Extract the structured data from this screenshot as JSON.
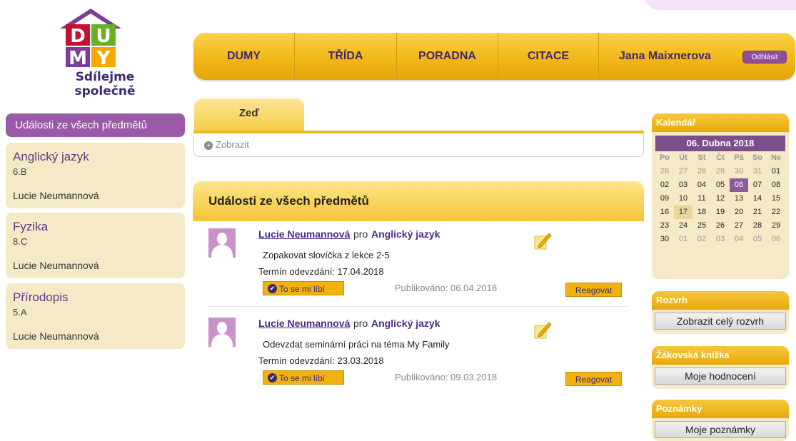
{
  "brand": {
    "logo_letters": [
      "D",
      "U",
      "M",
      "Y"
    ],
    "tagline": "Sdílejme společně",
    "colors": {
      "red": "#c8102e",
      "green": "#6ab023",
      "purple": "#7d3c98",
      "orange": "#f2a900"
    }
  },
  "nav": {
    "items": [
      {
        "label": "DUMY"
      },
      {
        "label": "TŘÍDA"
      },
      {
        "label": "PORADNA"
      },
      {
        "label": "CITACE"
      }
    ],
    "user_name": "Jana Maixnerova",
    "logout_label": "Odhlásit"
  },
  "left": {
    "active_label": "Události ze všech předmětů",
    "subjects": [
      {
        "name": "Anglický jazyk",
        "class": "6.B",
        "teacher": "Lucie Neumannová"
      },
      {
        "name": "Fyzika",
        "class": "8.C",
        "teacher": "Lucie Neumannová"
      },
      {
        "name": "Přírodopis",
        "class": "5.A",
        "teacher": "Lucie Neumannová"
      }
    ]
  },
  "wall": {
    "tab_label": "Zeď",
    "show_label": "Zobrazit"
  },
  "events": {
    "title": "Události ze všech předmětů",
    "items": [
      {
        "author": "Lucie Neumannová",
        "pro": "pro",
        "subject": "Anglický jazyk",
        "text": "Zopakovat slovíčka z lekce 2-5",
        "deadline": "Termín odevzdání: 17.04.2018",
        "like_label": "To se mi líbí",
        "published": "Publikováno: 06.04.2018",
        "react_label": "Reagovat"
      },
      {
        "author": "Lucie Neumannová",
        "pro": "pro",
        "subject": "Anglický jazyk",
        "text": "Odevzdat seminární práci na téma My Family",
        "deadline": "Termín odevzdání: 23.03.2018",
        "like_label": "To se mi líbí",
        "published": "Publikováno: 09.03.2018",
        "react_label": "Reagovat"
      }
    ]
  },
  "calendar": {
    "title": "Kalendář",
    "month_label": "06. Dubna 2018",
    "weekdays": [
      "Po",
      "Út",
      "St",
      "Čt",
      "Pá",
      "So",
      "Ne"
    ],
    "days": [
      {
        "d": "26",
        "state": "dim"
      },
      {
        "d": "27",
        "state": "dim"
      },
      {
        "d": "28",
        "state": "dim"
      },
      {
        "d": "29",
        "state": "dim"
      },
      {
        "d": "30",
        "state": "dim"
      },
      {
        "d": "31",
        "state": "dim"
      },
      {
        "d": "01",
        "state": ""
      },
      {
        "d": "02",
        "state": ""
      },
      {
        "d": "03",
        "state": ""
      },
      {
        "d": "04",
        "state": ""
      },
      {
        "d": "05",
        "state": ""
      },
      {
        "d": "06",
        "state": "sel"
      },
      {
        "d": "07",
        "state": ""
      },
      {
        "d": "08",
        "state": ""
      },
      {
        "d": "09",
        "state": ""
      },
      {
        "d": "10",
        "state": ""
      },
      {
        "d": "11",
        "state": ""
      },
      {
        "d": "12",
        "state": ""
      },
      {
        "d": "13",
        "state": ""
      },
      {
        "d": "14",
        "state": ""
      },
      {
        "d": "15",
        "state": ""
      },
      {
        "d": "16",
        "state": ""
      },
      {
        "d": "17",
        "state": "today"
      },
      {
        "d": "18",
        "state": ""
      },
      {
        "d": "19",
        "state": ""
      },
      {
        "d": "20",
        "state": ""
      },
      {
        "d": "21",
        "state": ""
      },
      {
        "d": "22",
        "state": ""
      },
      {
        "d": "23",
        "state": ""
      },
      {
        "d": "24",
        "state": ""
      },
      {
        "d": "25",
        "state": ""
      },
      {
        "d": "26",
        "state": ""
      },
      {
        "d": "27",
        "state": ""
      },
      {
        "d": "28",
        "state": ""
      },
      {
        "d": "29",
        "state": ""
      },
      {
        "d": "30",
        "state": ""
      },
      {
        "d": "01",
        "state": "dim"
      },
      {
        "d": "02",
        "state": "dim"
      },
      {
        "d": "03",
        "state": "dim"
      },
      {
        "d": "04",
        "state": "dim"
      },
      {
        "d": "05",
        "state": "dim"
      },
      {
        "d": "06",
        "state": "dim"
      }
    ]
  },
  "widgets": {
    "schedule": {
      "title": "Rozvrh",
      "button": "Zobrazit celý rozvrh"
    },
    "grades": {
      "title": "Žákovská knížka",
      "button": "Moje hodnocení"
    },
    "notes": {
      "title": "Poznámky",
      "button": "Moje poznámky"
    }
  }
}
